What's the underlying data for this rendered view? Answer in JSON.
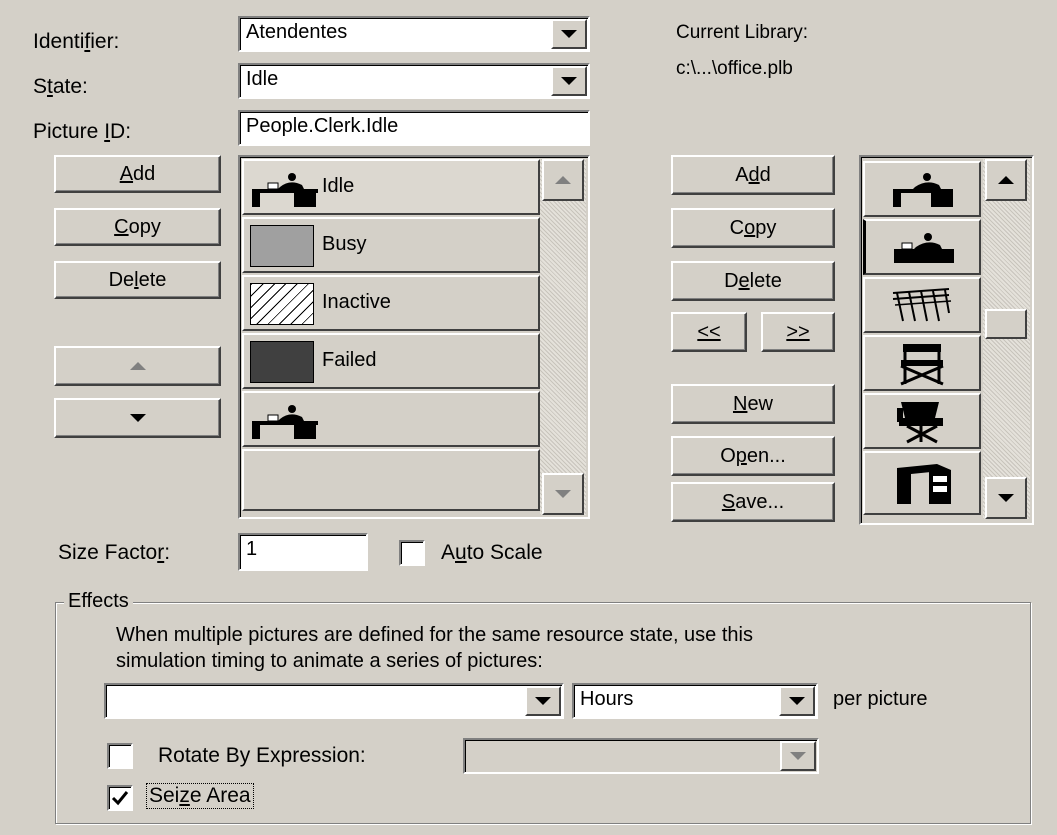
{
  "labels": {
    "identifier": {
      "pre": "Identi",
      "u": "f",
      "post": "ier:"
    },
    "state": {
      "pre": "S",
      "u": "t",
      "post": "ate:"
    },
    "picture_id": {
      "pre": "Picture ",
      "u": "I",
      "post": "D:"
    },
    "current_library": "Current Library:",
    "library_path": "c:\\...\\office.plb",
    "size_factor": {
      "pre": "Size Facto",
      "u": "r",
      "post": ":"
    }
  },
  "fields": {
    "identifier_value": "Atendentes",
    "state_value": "Idle",
    "picture_id_value": "People.Clerk.Idle",
    "size_factor_value": "1"
  },
  "left_buttons": {
    "add": {
      "pre": "",
      "u": "A",
      "post": "dd"
    },
    "copy": {
      "pre": "",
      "u": "C",
      "post": "opy"
    },
    "delete": {
      "pre": "De",
      "u": "l",
      "post": "ete"
    }
  },
  "picture_list": [
    {
      "label": "Idle",
      "swatch": "desk-clerk",
      "selected": true
    },
    {
      "label": "Busy",
      "swatch": "#a0a0a0",
      "selected": false
    },
    {
      "label": "Inactive",
      "swatch": "hatch",
      "selected": false
    },
    {
      "label": "Failed",
      "swatch": "#404040",
      "selected": false
    },
    {
      "label": "",
      "swatch": "desk-clerk",
      "selected": false
    },
    {
      "label": "",
      "swatch": "none",
      "selected": false
    }
  ],
  "library_buttons": {
    "add": {
      "pre": "A",
      "u": "d",
      "post": "d"
    },
    "copy": {
      "pre": "C",
      "u": "o",
      "post": "py"
    },
    "delete": {
      "pre": "D",
      "u": "e",
      "post": "lete"
    },
    "prev": {
      "pre": "",
      "u": "<<",
      "post": ""
    },
    "next": {
      "pre": "",
      "u": ">>",
      "post": ""
    },
    "new": {
      "pre": "",
      "u": "N",
      "post": "ew"
    },
    "open": {
      "pre": "O",
      "u": "p",
      "post": "en..."
    },
    "save": {
      "pre": "",
      "u": "S",
      "post": "ave..."
    }
  },
  "library_thumbnails": [
    "desk-clerk-icon",
    "desk-clerk-icon",
    "chairs-row-icon",
    "director-chair-icon",
    "office-chair-icon",
    "desk-icon"
  ],
  "auto_scale": {
    "pre": "A",
    "u": "u",
    "post": "to Scale",
    "checked": false
  },
  "effects": {
    "title": "Effects",
    "description_line1": "When multiple pictures are defined for the same resource state, use this",
    "description_line2": "simulation timing to animate a series of pictures:",
    "timing_value": "",
    "units_value": "Hours",
    "per_picture": "per picture",
    "rotate": {
      "label": "Rotate By Expression:",
      "checked": false
    },
    "seize": {
      "pre": "Sei",
      "u": "z",
      "post": "e Area",
      "checked": true
    }
  }
}
